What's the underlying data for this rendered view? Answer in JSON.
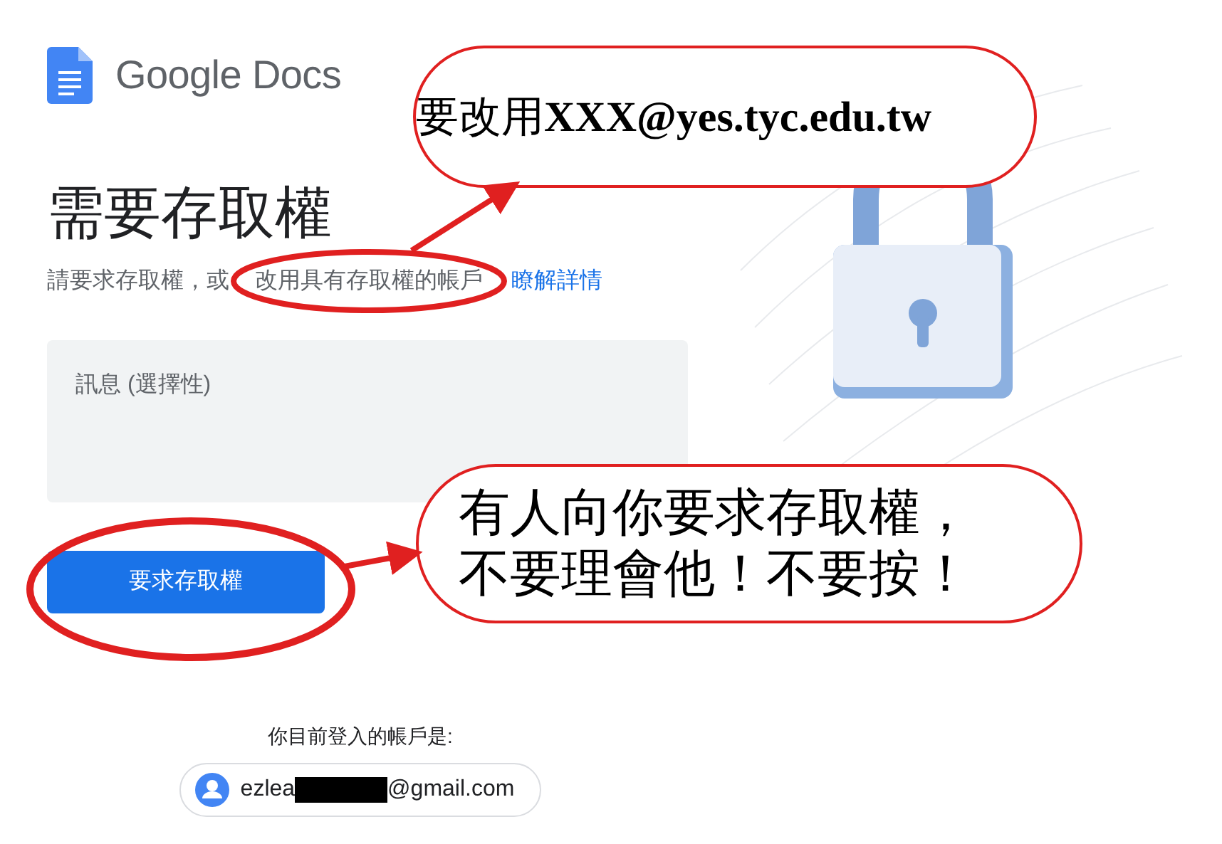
{
  "app": {
    "logo_text": "Google Docs"
  },
  "heading": "需要存取權",
  "subtitle": {
    "text": "請要求存取權，或",
    "highlighted_text": "改用具有存取權的帳戶",
    "link": "瞭解詳情"
  },
  "message_field": {
    "placeholder": "訊息 (選擇性)"
  },
  "request_button": "要求存取權",
  "account": {
    "label": "你目前登入的帳戶是:",
    "email_start": "ezlea",
    "email_end": "@gmail.com"
  },
  "annotations": [
    {
      "kind": "callout",
      "lines": [
        "要改用**XXX@yes.tyc.edu.tw**"
      ]
    },
    {
      "kind": "callout",
      "lines": [
        "有人向你要求存取權，",
        "不要理會他！不要按！"
      ]
    }
  ]
}
